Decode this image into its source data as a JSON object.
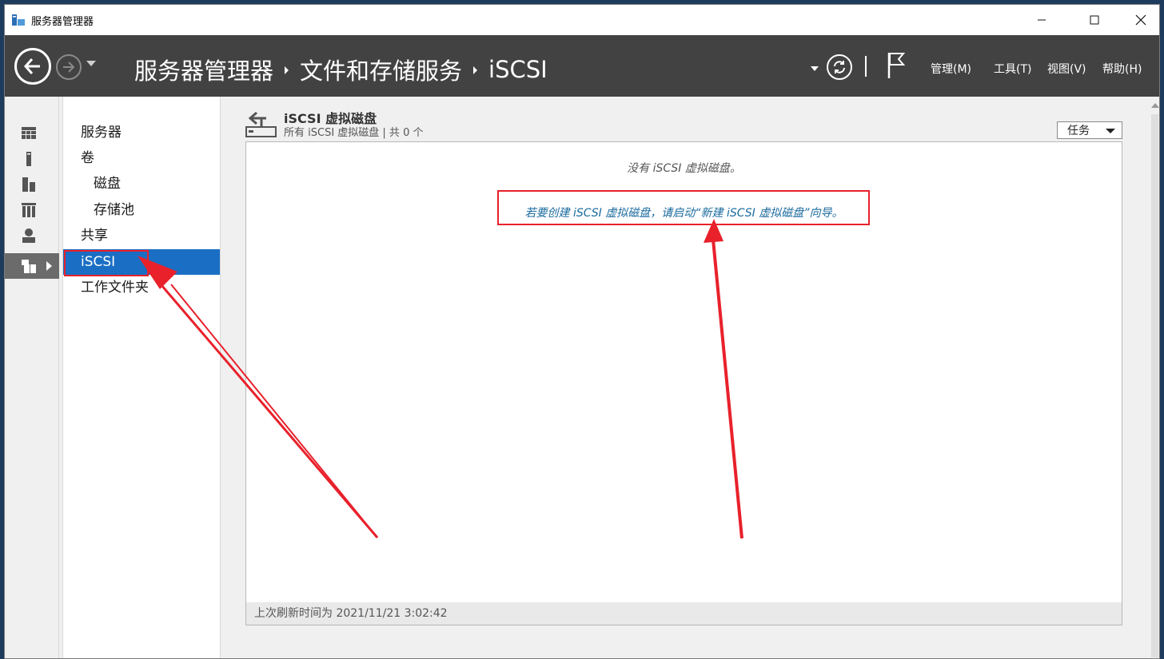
{
  "window": {
    "title": "服务器管理器"
  },
  "header": {
    "breadcrumb": [
      "服务器管理器",
      "文件和存储服务",
      "iSCSI"
    ],
    "menus": [
      "管理(M)",
      "工具(T)",
      "视图(V)",
      "帮助(H)"
    ]
  },
  "rail": {
    "icons": [
      "dashboard-icon",
      "local-server-icon",
      "all-servers-icon",
      "file-storage-services-icon",
      "role-icon",
      "file-storage-icon"
    ]
  },
  "nav": {
    "items": [
      {
        "label": "服务器",
        "level": 0
      },
      {
        "label": "卷",
        "level": 0
      },
      {
        "label": "磁盘",
        "level": 1
      },
      {
        "label": "存储池",
        "level": 1
      },
      {
        "label": "共享",
        "level": 0
      },
      {
        "label": "iSCSI",
        "level": 0,
        "selected": true
      },
      {
        "label": "工作文件夹",
        "level": 0
      }
    ]
  },
  "content": {
    "title": "iSCSI 虚拟磁盘",
    "subtitle": "所有 iSCSI 虚拟磁盘 | 共 0 个",
    "tasks_label": "任务",
    "empty_message": "没有 iSCSI 虚拟磁盘。",
    "wizard_link": "若要创建 iSCSI 虚拟磁盘，请启动“新建 iSCSI 虚拟磁盘”向导。",
    "last_refresh": "上次刷新时间为 2021/11/21 3:02:42"
  },
  "colors": {
    "header_bg": "#424242",
    "selected_bg": "#1a6fc4",
    "link": "#1a6a9e",
    "annotation": "#e8212b"
  }
}
